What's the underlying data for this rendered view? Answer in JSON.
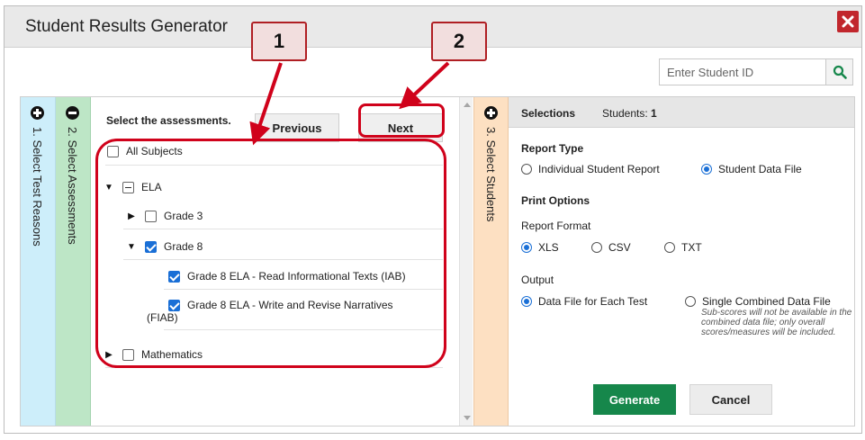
{
  "dialog": {
    "title": "Student Results Generator"
  },
  "search": {
    "placeholder": "Enter Student ID"
  },
  "steps": [
    {
      "label": "1. Select Test Reasons",
      "icon": "plus-circle-icon"
    },
    {
      "label": "2. Select Assessments",
      "icon": "minus-circle-icon"
    },
    {
      "label": "3. Select Students",
      "icon": "plus-circle-icon"
    }
  ],
  "assessments": {
    "instruction": "Select the assessments.",
    "previous_label": "Previous",
    "next_label": "Next",
    "all_subjects": "All Subjects",
    "ela": "ELA",
    "grade3": "Grade 3",
    "grade8": "Grade 8",
    "item1": "Grade 8 ELA - Read Informational Texts (IAB)",
    "item2_line1": "Grade 8 ELA - Write and Revise Narratives",
    "item2_line2": "(FIAB)",
    "math": "Mathematics"
  },
  "selections": {
    "header": "Selections",
    "students_label": "Students:",
    "students_count": "1",
    "report_type_title": "Report Type",
    "report_type_options": [
      "Individual Student Report",
      "Student Data File"
    ],
    "report_type_selected": "Student Data File",
    "print_options_title": "Print Options",
    "report_format_title": "Report Format",
    "format_options": [
      "XLS",
      "CSV",
      "TXT"
    ],
    "format_selected": "XLS",
    "output_title": "Output",
    "output_options": [
      "Data File for Each Test",
      "Single Combined Data File"
    ],
    "output_selected": "Data File for Each Test",
    "note": "Sub-scores will not be available in the combined data file; only overall scores/measures will be included.",
    "generate_label": "Generate",
    "cancel_label": "Cancel"
  },
  "callouts": [
    "1",
    "2"
  ],
  "colors": {
    "close": "#c1272d",
    "generate": "#16874b",
    "highlight": "#d0021b",
    "step1": "#cdeefa",
    "step2": "#bde6c6",
    "step3": "#fde0c2",
    "checkbox": "#1a6fd6"
  }
}
